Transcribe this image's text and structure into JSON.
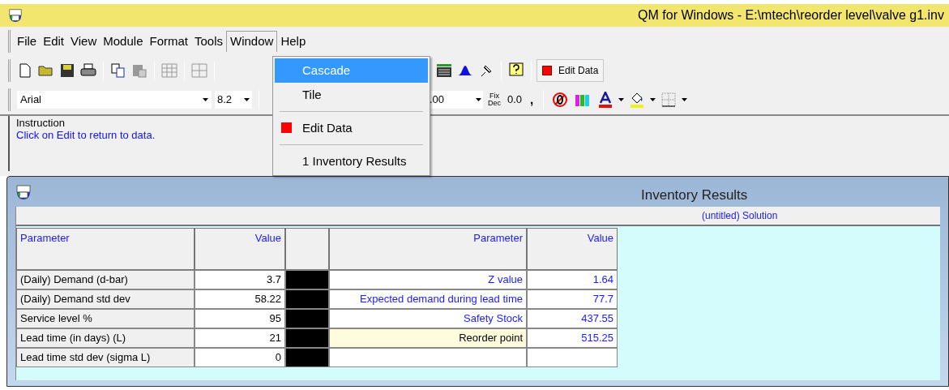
{
  "window": {
    "title": "QM for Windows - E:\\mtech\\reorder level\\valve g1.inv"
  },
  "menu": [
    {
      "label": "File",
      "selected": false
    },
    {
      "label": "Edit",
      "selected": false
    },
    {
      "label": "View",
      "selected": false
    },
    {
      "label": "Module",
      "selected": false
    },
    {
      "label": "Format",
      "selected": false
    },
    {
      "label": "Tools",
      "selected": false
    },
    {
      "label": "Window",
      "selected": true
    },
    {
      "label": "Help",
      "selected": false
    }
  ],
  "toolbar": {
    "edit_button": "Edit Data",
    "font": "Arial",
    "font_size": "8.2",
    "decimals": ".00",
    "fix_dec_top": "Fix",
    "fix_dec_bottom": "Dec",
    "format_decimal": "0.0",
    "comma": ","
  },
  "dropdown": [
    {
      "kind": "item",
      "label": "Cascade",
      "selected": true
    },
    {
      "kind": "item",
      "label": "Tile",
      "selected": false
    },
    {
      "kind": "separator"
    },
    {
      "kind": "edit",
      "label": "Edit Data",
      "selected": false
    },
    {
      "kind": "separator"
    },
    {
      "kind": "item",
      "label": "1 Inventory Results",
      "selected": false
    }
  ],
  "instruction": {
    "legend": "Instruction",
    "text": "Click on Edit to return to data."
  },
  "results": {
    "title": "Inventory Results",
    "subtitle": "(untitled) Solution",
    "columns": [
      "Parameter",
      "Value",
      "Parameter",
      "Value"
    ],
    "rows": [
      {
        "param": "(Daily) Demand (d-bar)",
        "value": "3.7",
        "result": "Z value",
        "result_value": "1.64",
        "highlight": false
      },
      {
        "param": "(Daily) Demand std dev",
        "value": "58.22",
        "result": "Expected demand during lead time",
        "result_value": "77.7",
        "highlight": false
      },
      {
        "param": "Service level %",
        "value": "95",
        "result": "Safety Stock",
        "result_value": "437.55",
        "highlight": false
      },
      {
        "param": "Lead time (in days) (L)",
        "value": "21",
        "result": "Reorder point",
        "result_value": "515.25",
        "highlight": true
      },
      {
        "param": "Lead time std dev (sigma L)",
        "value": "0",
        "result": "",
        "result_value": "",
        "highlight": false
      }
    ]
  }
}
